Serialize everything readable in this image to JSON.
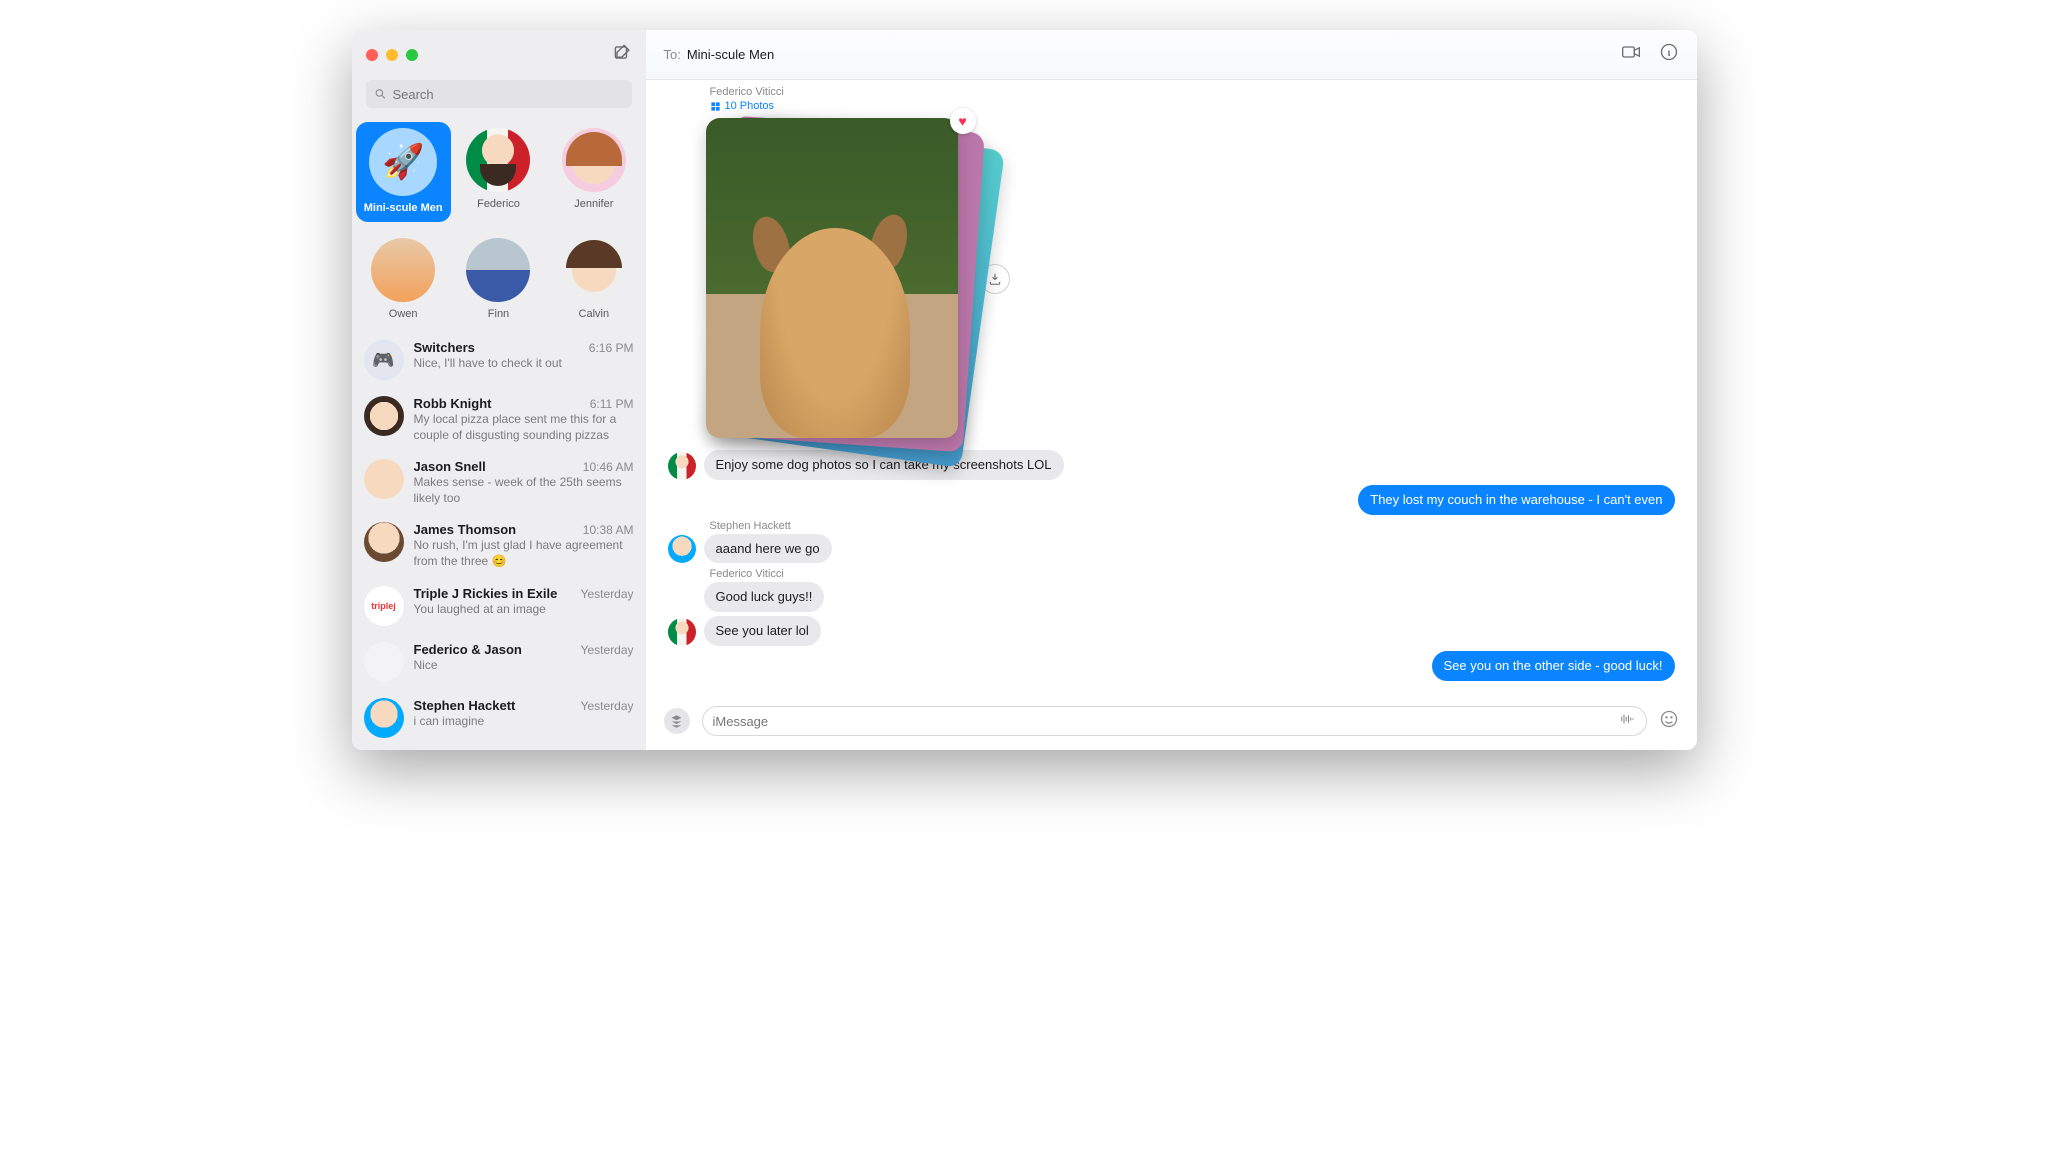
{
  "search": {
    "placeholder": "Search"
  },
  "header": {
    "to_label": "To:",
    "to_name": "Mini-scule Men"
  },
  "pins": [
    {
      "label": "Mini-scule Men",
      "selected": true,
      "emoji": "🚀",
      "av": "rocket"
    },
    {
      "label": "Federico",
      "av": "federico"
    },
    {
      "label": "Jennifer",
      "av": "jennifer"
    },
    {
      "label": "Owen",
      "av": "owen"
    },
    {
      "label": "Finn",
      "av": "finn"
    },
    {
      "label": "Calvin",
      "av": "calvin"
    }
  ],
  "conversations": [
    {
      "title": "Switchers",
      "time": "6:16 PM",
      "preview": "Nice, I'll have to check it out",
      "av": "game",
      "emoji": "🎮"
    },
    {
      "title": "Robb Knight",
      "time": "6:11 PM",
      "preview": "My local pizza place sent me this for a couple of disgusting sounding pizzas",
      "av": "robb"
    },
    {
      "title": "Jason Snell",
      "time": "10:46 AM",
      "preview": "Makes sense - week of the 25th seems likely too",
      "av": "jason"
    },
    {
      "title": "James Thomson",
      "time": "10:38 AM",
      "preview": "No rush, I'm just glad I have agreement from the three 😊",
      "av": "james"
    },
    {
      "title": "Triple J Rickies in Exile",
      "time": "Yesterday",
      "preview": "You laughed at an image",
      "av": "triplej",
      "text": "triplej"
    },
    {
      "title": "Federico & Jason",
      "time": "Yesterday",
      "preview": "Nice",
      "av": "fj"
    },
    {
      "title": "Stephen Hackett",
      "time": "Yesterday",
      "preview": "i can imagine",
      "av": "stephen"
    }
  ],
  "thread": {
    "photo_sender": "Federico Viticci",
    "photo_count": "10 Photos",
    "msgs": [
      {
        "dir": "in",
        "sender": "Federico Viticci",
        "av": "federico",
        "text": "Enjoy some dog photos so I can take my screenshots LOL",
        "show_av": true,
        "show_sender": false
      },
      {
        "dir": "out",
        "text": "They lost my couch in the warehouse - I can't even"
      },
      {
        "dir": "in",
        "sender": "Stephen Hackett",
        "av": "stephen",
        "text": "aaand here we go",
        "show_av": true,
        "show_sender": true
      },
      {
        "dir": "in",
        "sender": "Federico Viticci",
        "av": "federico",
        "text": "Good luck guys!!",
        "show_av": false,
        "show_sender": true
      },
      {
        "dir": "in",
        "sender": "Federico Viticci",
        "av": "federico",
        "text": "See you later lol",
        "show_av": true,
        "show_sender": false
      },
      {
        "dir": "out",
        "text": "See you on the other side - good luck!"
      }
    ]
  },
  "compose": {
    "placeholder": "iMessage"
  }
}
